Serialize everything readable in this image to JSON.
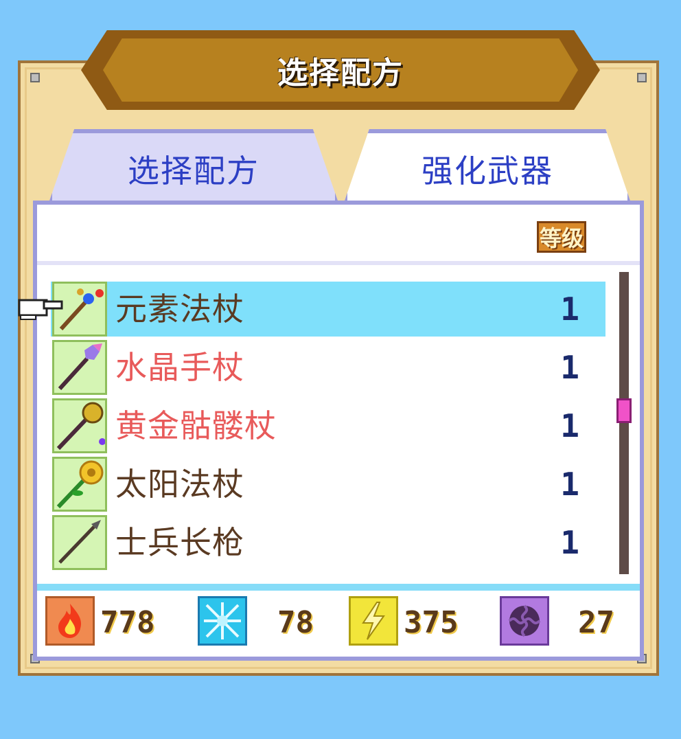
{
  "window": {
    "title": "选择配方"
  },
  "tabs": [
    {
      "label": "选择配方",
      "active": false
    },
    {
      "label": "强化武器",
      "active": true
    }
  ],
  "list_header": {
    "level_label": "等级"
  },
  "recipes": [
    {
      "name": "元素法杖",
      "level": "1",
      "color": "#5a3a22",
      "selected": true,
      "icon": "element-staff-icon"
    },
    {
      "name": "水晶手杖",
      "level": "1",
      "color": "#e85a5a",
      "selected": false,
      "icon": "crystal-staff-icon"
    },
    {
      "name": "黄金骷髅杖",
      "level": "1",
      "color": "#e85a5a",
      "selected": false,
      "icon": "golden-skull-staff-icon"
    },
    {
      "name": "太阳法杖",
      "level": "1",
      "color": "#5a3a22",
      "selected": false,
      "icon": "sun-staff-icon"
    },
    {
      "name": "士兵长枪",
      "level": "1",
      "color": "#5a3a22",
      "selected": false,
      "icon": "soldier-spear-icon"
    }
  ],
  "resources": [
    {
      "icon": "fire-icon",
      "value": "778",
      "color": "#f08a50"
    },
    {
      "icon": "ice-icon",
      "value": "78",
      "color": "#2cc4ec"
    },
    {
      "icon": "lightning-icon",
      "value": "375",
      "color": "#f2e53a"
    },
    {
      "icon": "dark-vortex-icon",
      "value": "27",
      "color": "#b27ae0"
    }
  ]
}
